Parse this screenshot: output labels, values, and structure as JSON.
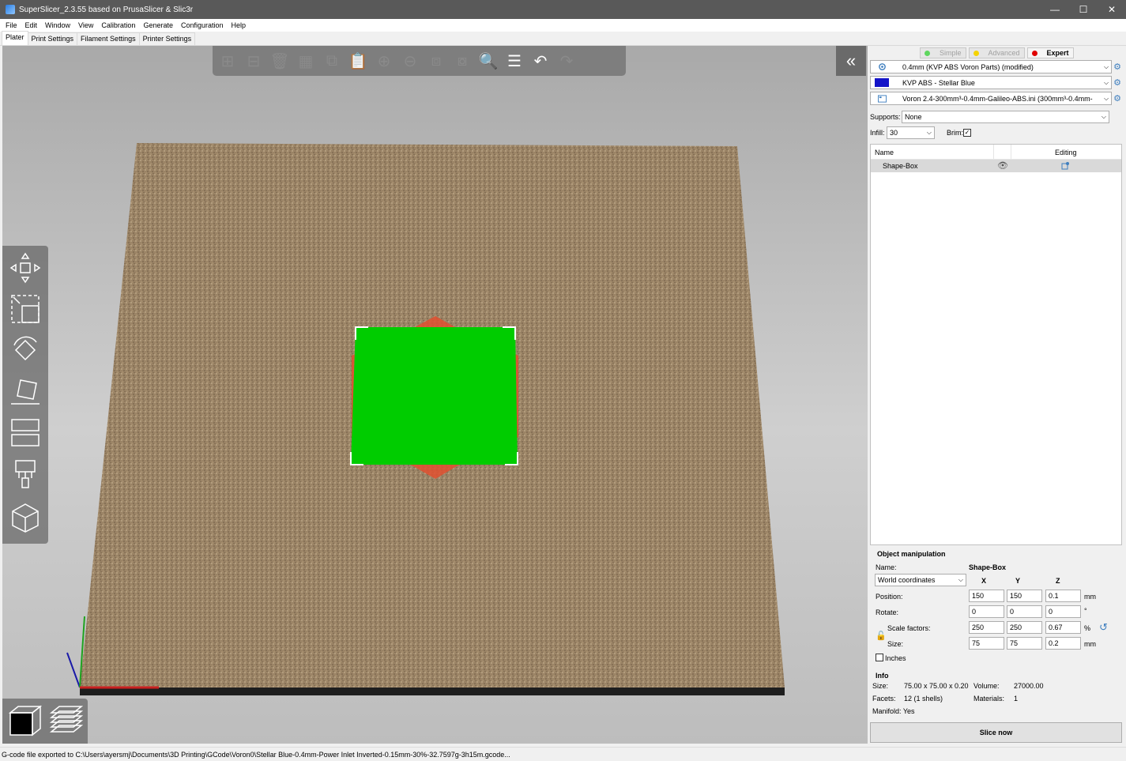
{
  "window": {
    "title": "SuperSlicer_2.3.55 based on PrusaSlicer & Slic3r",
    "minimize": "—",
    "maximize": "☐",
    "close": "✕"
  },
  "menu": [
    "File",
    "Edit",
    "Window",
    "View",
    "Calibration",
    "Generate",
    "Configuration",
    "Help"
  ],
  "tabs": [
    "Plater",
    "Print Settings",
    "Filament Settings",
    "Printer Settings"
  ],
  "modes": {
    "simple": "Simple",
    "advanced": "Advanced",
    "expert": "Expert"
  },
  "presets": {
    "print": "0.4mm (KVP ABS Voron Parts) (modified)",
    "filament": "KVP ABS - Stellar Blue",
    "filament_color": "#1414c8",
    "printer": "Voron 2.4-300mm³-0.4mm-Galileo-ABS.ini (300mm³-0.4mm-"
  },
  "supports": {
    "label": "Supports:",
    "value": "None"
  },
  "infill": {
    "label": "Infill:",
    "value": "30"
  },
  "brim": {
    "label": "Brim:",
    "checked": "✓"
  },
  "object_list": {
    "col_name": "Name",
    "col_editing": "Editing",
    "rows": [
      {
        "name": "Shape-Box"
      }
    ]
  },
  "manipulation": {
    "title": "Object manipulation",
    "name_label": "Name:",
    "name_value": "Shape-Box",
    "coord_system": "World coordinates",
    "axis_x": "X",
    "axis_y": "Y",
    "axis_z": "Z",
    "position": {
      "label": "Position:",
      "x": "150",
      "y": "150",
      "z": "0.1",
      "unit": "mm"
    },
    "rotate": {
      "label": "Rotate:",
      "x": "0",
      "y": "0",
      "z": "0",
      "unit": "°"
    },
    "scale": {
      "label": "Scale factors:",
      "x": "250",
      "y": "250",
      "z": "0.67",
      "unit": "%"
    },
    "size": {
      "label": "Size:",
      "x": "75",
      "y": "75",
      "z": "0.2",
      "unit": "mm"
    },
    "inches_label": "Inches"
  },
  "info": {
    "title": "Info",
    "size_label": "Size:",
    "size_value": "75.00 x 75.00 x 0.20",
    "volume_label": "Volume:",
    "volume_value": "27000.00",
    "facets_label": "Facets:",
    "facets_value": "12 (1 shells)",
    "materials_label": "Materials:",
    "materials_value": "1",
    "manifold": "Manifold: Yes"
  },
  "slice_button": "Slice now",
  "status_bar": "G-code file exported to C:\\Users\\ayersmj\\Documents\\3D Printing\\GCode\\Voron0\\Stellar Blue-0.4mm-Power Inlet Inverted-0.15mm-30%-32.7597g-3h15m.gcode...",
  "colors": {
    "object": "#00cc00",
    "object_shadow": "#e05030",
    "bed": "#9b8466",
    "accent": "#3f7fbf"
  }
}
